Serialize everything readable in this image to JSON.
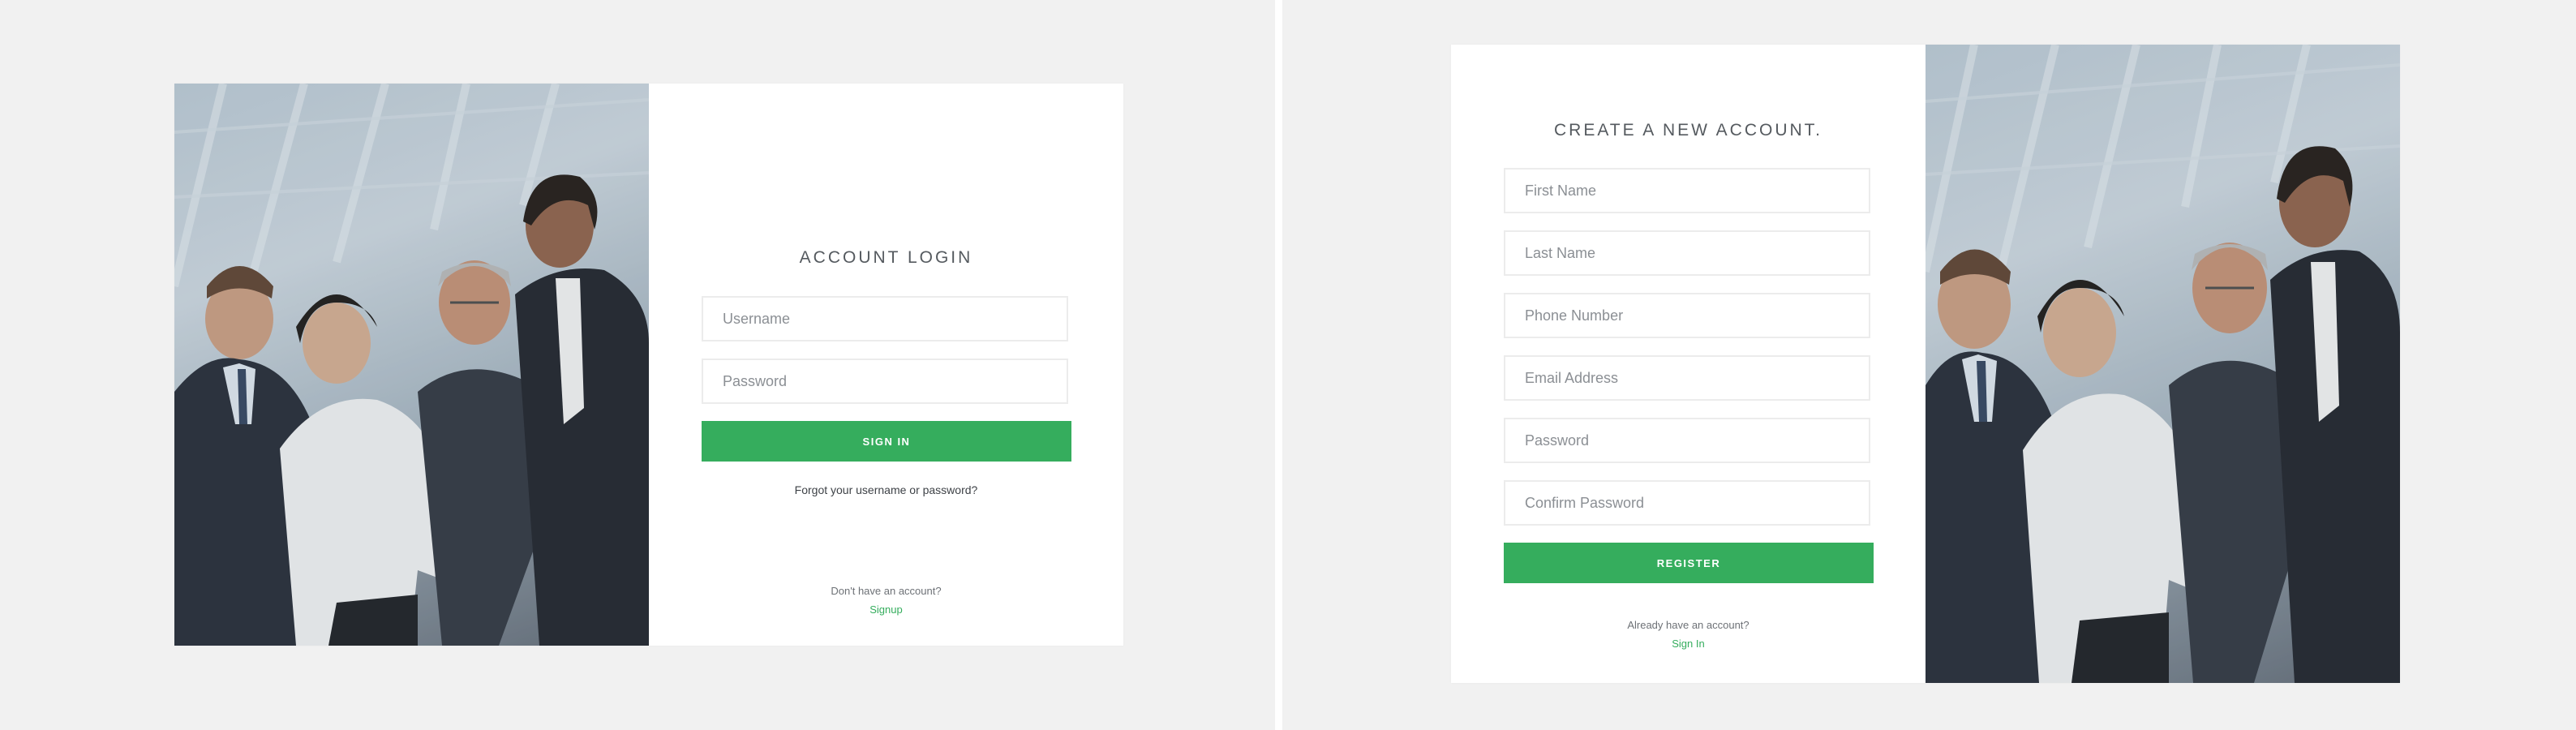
{
  "login": {
    "title": "ACCOUNT LOGIN",
    "username_placeholder": "Username",
    "password_placeholder": "Password",
    "signin_label": "SIGN IN",
    "forgot_label": "Forgot your username or password?",
    "no_account_text": "Don't have an account?",
    "signup_label": "Signup"
  },
  "register": {
    "title": "CREATE A NEW ACCOUNT.",
    "first_name_placeholder": "First Name",
    "last_name_placeholder": "Last Name",
    "phone_placeholder": "Phone Number",
    "email_placeholder": "Email Address",
    "password_placeholder": "Password",
    "confirm_password_placeholder": "Confirm Password",
    "register_label": "REGISTER",
    "have_account_text": "Already have an account?",
    "signin_label": "Sign In"
  },
  "colors": {
    "accent": "#35ad5d",
    "background": "#f1f1f1",
    "card": "#ffffff"
  }
}
